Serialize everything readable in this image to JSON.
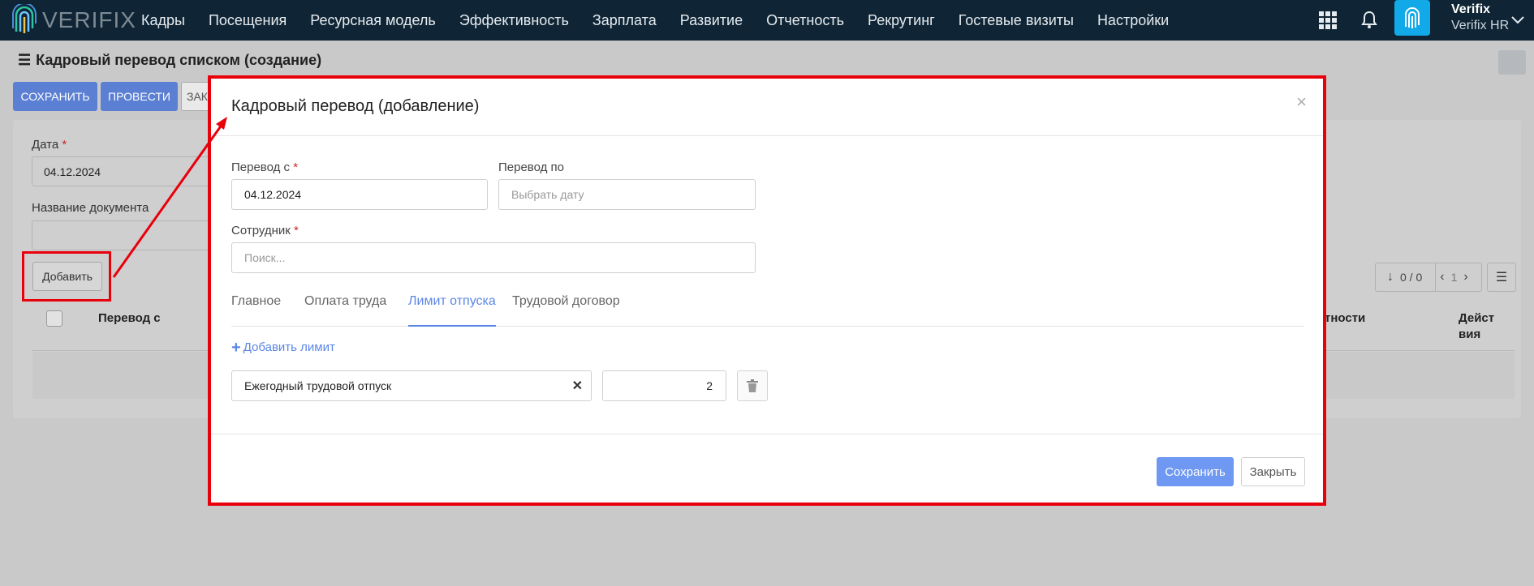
{
  "brand": {
    "name": "VERIFIX"
  },
  "nav": {
    "items": [
      "Кадры",
      "Посещения",
      "Ресурсная модель",
      "Эффективность",
      "Зарплата",
      "Развитие",
      "Отчетность",
      "Рекрутинг",
      "Гостевые визиты",
      "Настройки"
    ]
  },
  "user": {
    "name": "Verifix",
    "org": "Verifix HR"
  },
  "page": {
    "title": "Кадровый перевод списком (создание)",
    "buttons": {
      "save": "СОХРАНИТЬ",
      "post": "ПРОВЕСТИ",
      "close_partial": "ЗАК"
    },
    "date_label": "Дата",
    "date_value": "04.12.2024",
    "docname_label": "Название документа",
    "add_button": "Добавить",
    "table": {
      "col_transfer_from": "Перевод с",
      "col_position": "тности",
      "col_actions_1": "Дейст",
      "col_actions_2": "вия"
    },
    "pager": {
      "count": "0 / 0",
      "page": "1"
    }
  },
  "modal": {
    "title": "Кадровый перевод (добавление)",
    "close": "×",
    "from_label": "Перевод с",
    "from_value": "04.12.2024",
    "to_label": "Перевод по",
    "to_placeholder": "Выбрать дату",
    "employee_label": "Сотрудник",
    "employee_placeholder": "Поиск...",
    "tabs": [
      "Главное",
      "Оплата труда",
      "Лимит отпуска",
      "Трудовой договор"
    ],
    "active_tab": "Лимит отпуска",
    "add_limit": "Добавить лимит",
    "limit_type": "Ежегодный трудовой отпуск",
    "limit_days": "2",
    "save": "Сохранить",
    "close_button": "Закрыть"
  },
  "colors": {
    "nav_bg": "#0f2535",
    "accent": "#5b86e5",
    "primary_button": "#6e98f2",
    "annotation_red": "#e8000b",
    "avatar_bg": "#11a9e8"
  }
}
